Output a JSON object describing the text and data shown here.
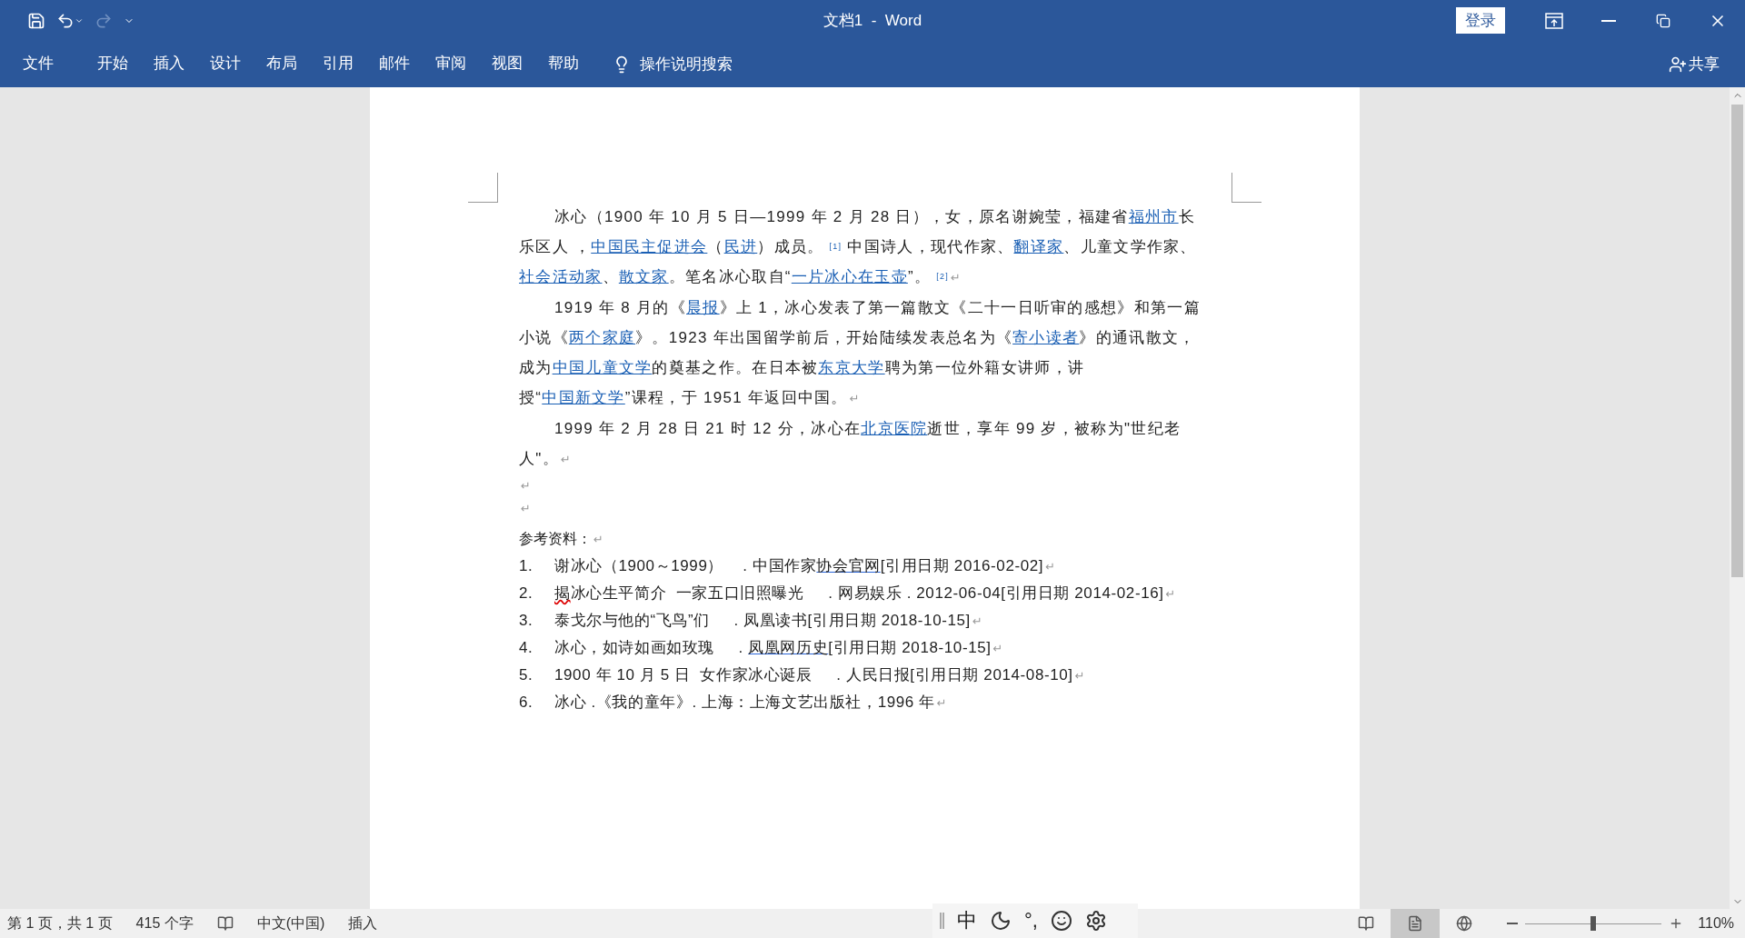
{
  "title_bar": {
    "title": "文档1  -  Word",
    "sign_in": "登录",
    "redo_disabled": true
  },
  "tabs": [
    {
      "label": "文件",
      "selected": false
    },
    {
      "label": "开始",
      "selected": false
    },
    {
      "label": "插入",
      "selected": false
    },
    {
      "label": "设计",
      "selected": false
    },
    {
      "label": "布局",
      "selected": false
    },
    {
      "label": "引用",
      "selected": false
    },
    {
      "label": "邮件",
      "selected": false
    },
    {
      "label": "审阅",
      "selected": false
    },
    {
      "label": "视图",
      "selected": false
    },
    {
      "label": "帮助",
      "selected": false
    }
  ],
  "tell_me": "操作说明搜索",
  "share": "共享",
  "document": {
    "paragraphs": [
      {
        "kind": "body",
        "mark": "↵",
        "segments": [
          {
            "kind": "text",
            "text": "冰心（1900 年 10 月 5 日—1999 年 2 月 28 日），女，原名谢婉莹，福建省"
          },
          {
            "kind": "link",
            "text": "福州市"
          },
          {
            "kind": "text",
            "text": "长乐区人 ，"
          },
          {
            "kind": "link",
            "text": "中国民主促进会"
          },
          {
            "kind": "text",
            "text": "（"
          },
          {
            "kind": "link",
            "text": "民进"
          },
          {
            "kind": "text",
            "text": "）成员。 "
          },
          {
            "kind": "ref",
            "text": "[1]"
          },
          {
            "kind": "text",
            "text": " 中国诗人，现代作家、"
          },
          {
            "kind": "link",
            "text": "翻译家"
          },
          {
            "kind": "text",
            "text": "、儿童文学作家、"
          },
          {
            "kind": "link",
            "text": "社会活动家"
          },
          {
            "kind": "text",
            "text": "、"
          },
          {
            "kind": "link",
            "text": "散文家"
          },
          {
            "kind": "text",
            "text": "。笔名冰心取自“"
          },
          {
            "kind": "link",
            "text": "一片冰心在玉壶"
          },
          {
            "kind": "text",
            "text": "”。 "
          },
          {
            "kind": "ref",
            "text": "[2]"
          }
        ]
      },
      {
        "kind": "body",
        "mark": "↵",
        "segments": [
          {
            "kind": "text",
            "text": "1919 年 8 月的《"
          },
          {
            "kind": "link",
            "text": "晨报"
          },
          {
            "kind": "text",
            "text": "》上 1，冰心发表了第一篇散文《二十一日听审的感想》和第一篇小说《"
          },
          {
            "kind": "link",
            "text": "两个家庭"
          },
          {
            "kind": "text",
            "text": "》。1923 年出国留学前后，开始陆续发表总名为《"
          },
          {
            "kind": "link",
            "text": "寄小读者"
          },
          {
            "kind": "text",
            "text": "》的通讯散文，成为"
          },
          {
            "kind": "link",
            "text": "中国儿童文学"
          },
          {
            "kind": "text",
            "text": "的奠基之作。在日本被"
          },
          {
            "kind": "link",
            "text": "东京大学"
          },
          {
            "kind": "text",
            "text": "聘为第一位外籍女讲师，讲授“"
          },
          {
            "kind": "link",
            "text": "中国新文学"
          },
          {
            "kind": "text",
            "text": "”课程，于 1951 年返回中国。"
          }
        ]
      },
      {
        "kind": "body",
        "mark": "↵",
        "segments": [
          {
            "kind": "text",
            "text": "1999 年 2 月 28 日 21 时 12 分，冰心在"
          },
          {
            "kind": "link",
            "text": "北京医院"
          },
          {
            "kind": "text",
            "text": "逝世，享年 99 岁，被称为\"世纪老人\"。"
          }
        ]
      },
      {
        "kind": "empty",
        "mark": "↵"
      },
      {
        "kind": "empty",
        "mark": "↵"
      }
    ],
    "references": {
      "heading": "参考资料：",
      "mark": "↵",
      "items": [
        {
          "number": "1.",
          "mark": "↵",
          "segments": [
            {
              "kind": "text",
              "text": "谢冰心（1900～1999）    . 中国作家"
            },
            {
              "kind": "link",
              "text": "协会官网"
            },
            {
              "kind": "text",
              "text": "[引用日期 2016-02-02]"
            }
          ]
        },
        {
          "number": "2.",
          "mark": "↵",
          "segments": [
            {
              "kind": "misspelled",
              "text": "揭"
            },
            {
              "kind": "text",
              "text": "冰心生平简介  一家五口旧照曝光     . 网易娱乐 . 2012-06-04[引用日期 2014-02-16]"
            }
          ]
        },
        {
          "number": "3.",
          "mark": "↵",
          "segments": [
            {
              "kind": "text",
              "text": "泰戈尔与他的“飞鸟”们     . 凤凰读书[引用日期 2018-10-15]"
            }
          ]
        },
        {
          "number": "4.",
          "mark": "↵",
          "segments": [
            {
              "kind": "text",
              "text": "冰心，如诗如画如玫瑰     . "
            },
            {
              "kind": "link",
              "text": "凤凰网历史"
            },
            {
              "kind": "text",
              "text": "[引用日期 2018-10-15]"
            }
          ]
        },
        {
          "number": "5.",
          "mark": "↵",
          "segments": [
            {
              "kind": "text",
              "text": "1900 年 10 月 5 日  女作家冰心诞辰     . 人民日报[引用日期 2014-08-10]"
            }
          ]
        },
        {
          "number": "6.",
          "mark": "↵",
          "segments": [
            {
              "kind": "text",
              "text": "冰心 .《我的童年》. 上海：上海文艺出版社，1996 年"
            }
          ]
        }
      ]
    }
  },
  "status_bar": {
    "page": "第 1 页，共 1 页",
    "words": "415 个字",
    "language": "中文(中国)",
    "mode": "插入",
    "ime": {
      "mode": "中",
      "punctuation": "°,"
    },
    "views": [
      {
        "kind": "read",
        "selected": false
      },
      {
        "kind": "print",
        "selected": true
      },
      {
        "kind": "web",
        "selected": false
      }
    ],
    "zoom": {
      "level": 0.5,
      "label": "110%"
    }
  }
}
